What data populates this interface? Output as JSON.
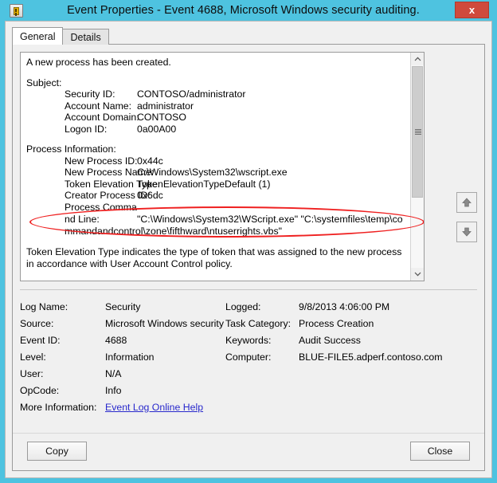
{
  "window": {
    "title": "Event Properties - Event 4688, Microsoft Windows security auditing.",
    "icon": "event-log-icon",
    "close_label": "x",
    "border_color": "#4ec3e0"
  },
  "tabs": [
    {
      "label": "General",
      "active": true
    },
    {
      "label": "Details",
      "active": false
    }
  ],
  "event": {
    "summary": "A new process has been created.",
    "sections": [
      {
        "heading": "Subject:",
        "rows": [
          {
            "label": "Security ID:",
            "value": "CONTOSO/administrator"
          },
          {
            "label": "Account Name:",
            "value": "administrator"
          },
          {
            "label": "Account Domain:",
            "value": "CONTOSO"
          },
          {
            "label": "Logon ID:",
            "value": "0a00A00"
          }
        ]
      },
      {
        "heading": "Process Information:",
        "rows": [
          {
            "label": "New Process ID:",
            "value": "0x44c"
          },
          {
            "label": "New Process Name:",
            "value": "C:\\Windows\\System32\\wscript.exe"
          },
          {
            "label": "Token Elevation Type:",
            "value": "TokenElevationTypeDefault (1)"
          },
          {
            "label": "Creator Process ID:",
            "value": "0x6dc"
          }
        ]
      }
    ],
    "command_line": {
      "label": "Process Command Line:",
      "value": "\"C:\\Windows\\System32\\WScript.exe\" \"C:\\systemfiles\\temp\\commandandcontrol\\zone\\fifthward\\ntuserrights.vbs\"",
      "highlighted": true,
      "highlight_color": "#ef2020"
    },
    "note": "Token Elevation Type indicates the type of token that was assigned to the new process in accordance with User Account Control policy."
  },
  "scrollbar": {
    "up_arrow": "chevron-up-icon",
    "down_arrow": "chevron-down-icon"
  },
  "nav_buttons": [
    {
      "name": "previous-event-button",
      "icon": "arrow-up-icon"
    },
    {
      "name": "next-event-button",
      "icon": "arrow-down-icon"
    }
  ],
  "metadata": {
    "left": [
      {
        "label": "Log Name:",
        "value": "Security"
      },
      {
        "label": "Source:",
        "value": "Microsoft Windows security"
      },
      {
        "label": "Event ID:",
        "value": "4688"
      },
      {
        "label": "Level:",
        "value": "Information"
      },
      {
        "label": "User:",
        "value": "N/A"
      },
      {
        "label": "OpCode:",
        "value": "Info"
      }
    ],
    "right": [
      {
        "label": "Logged:",
        "value": "9/8/2013 4:06:00 PM"
      },
      {
        "label": "Task Category:",
        "value": "Process Creation"
      },
      {
        "label": "Keywords:",
        "value": "Audit Success"
      },
      {
        "label": "Computer:",
        "value": "BLUE-FILE5.adperf.contoso.com"
      }
    ],
    "more_info_label": "More Information:",
    "more_info_link": "Event Log Online Help"
  },
  "footer": {
    "copy_label": "Copy",
    "close_label": "Close"
  }
}
